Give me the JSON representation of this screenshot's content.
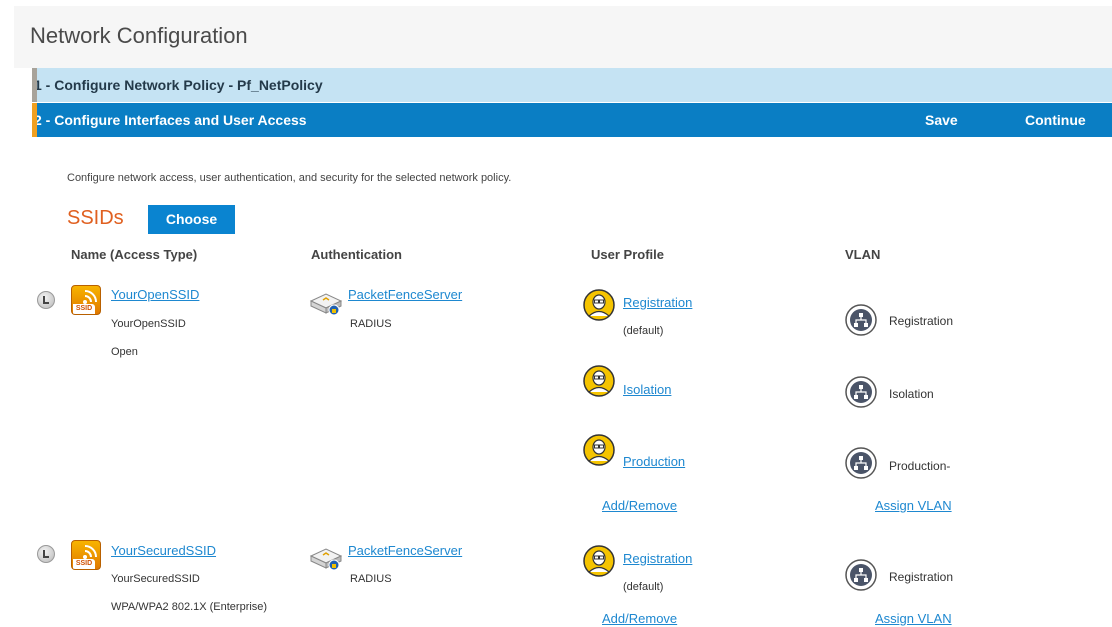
{
  "page": {
    "title": "Network Configuration"
  },
  "steps": {
    "step1": "1 - Configure Network Policy - Pf_NetPolicy",
    "step2": "2 - Configure Interfaces and User Access",
    "save": "Save",
    "continue": "Continue"
  },
  "description": "Configure network access, user authentication, and security for the selected network policy.",
  "ssids": {
    "title": "SSIDs",
    "choose": "Choose",
    "columns": {
      "name": "Name (Access Type)",
      "auth": "Authentication",
      "profile": "User Profile",
      "vlan": "VLAN"
    },
    "rows": [
      {
        "name_link": "YourOpenSSID",
        "name": "YourOpenSSID",
        "access": "Open",
        "auth_link": "PacketFenceServer",
        "auth_type": "RADIUS",
        "profiles": [
          {
            "name": "Registration",
            "note": "(default)",
            "vlan": "Registration"
          },
          {
            "name": "Isolation",
            "note": "",
            "vlan": "Isolation"
          },
          {
            "name": "Production",
            "note": "",
            "vlan": "Production-"
          }
        ],
        "add_remove": "Add/Remove",
        "assign_vlan": "Assign VLAN"
      },
      {
        "name_link": "YourSecuredSSID",
        "name": "YourSecuredSSID",
        "access": "WPA/WPA2 802.1X (Enterprise)",
        "auth_link": "PacketFenceServer",
        "auth_type": "RADIUS",
        "profiles": [
          {
            "name": "Registration",
            "note": "(default)",
            "vlan": "Registration"
          }
        ],
        "add_remove": "Add/Remove",
        "assign_vlan": "Assign VLAN"
      }
    ]
  },
  "icons": {
    "ssid": "ssid-wifi-icon",
    "auth": "radius-server-icon",
    "profile": "user-profile-icon",
    "vlan": "network-vlan-icon",
    "select": "radio-select-icon"
  },
  "colors": {
    "step1_bg": "#c5e3f3",
    "step2_bg": "#0a7ec4",
    "accent_orange": "#e06020",
    "link": "#1e88d0"
  }
}
